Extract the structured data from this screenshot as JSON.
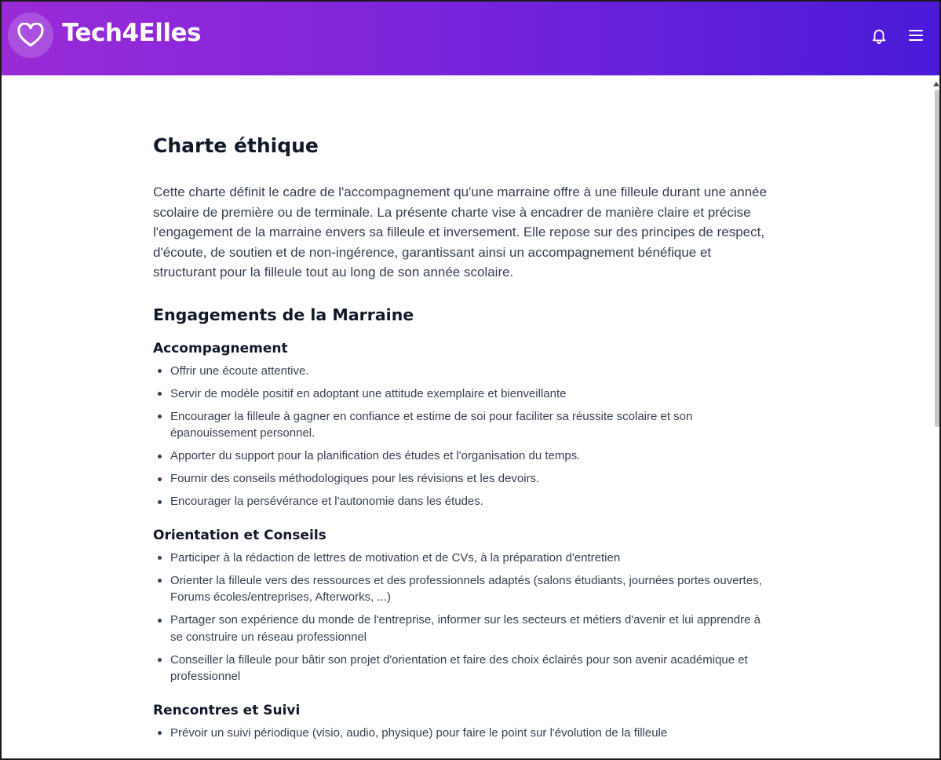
{
  "header": {
    "brand": "Tech4Elles",
    "logo_icon": "heart-icon",
    "notification_icon": "bell-icon",
    "menu_icon": "hamburger-menu-icon",
    "gradient_start": "#9a2bd6",
    "gradient_end": "#4a1ad8"
  },
  "page": {
    "title": "Charte éthique",
    "intro": "Cette charte définit le cadre de l'accompagnement qu'une marraine offre à une filleule durant une année scolaire de première ou de terminale. La présente charte vise à encadrer de manière claire et précise l'engagement de la marraine envers sa filleule et inversement. Elle repose sur des principes de respect, d'écoute, de soutien et de non-ingérence, garantissant ainsi un accompagnement bénéfique et structurant pour la filleule tout au long de son année scolaire.",
    "section_title": "Engagements de la Marraine",
    "subsections": [
      {
        "title": "Accompagnement",
        "items": [
          "Offrir une écoute attentive.",
          "Servir de modèle positif en adoptant une attitude exemplaire et bienveillante",
          "Encourager la filleule à gagner en confiance et estime de soi pour faciliter sa réussite scolaire et son épanouissement personnel.",
          "Apporter du support pour la planification des études et l'organisation du temps.",
          "Fournir des conseils méthodologiques pour les révisions et les devoirs.",
          "Encourager la persévérance et l'autonomie dans les études."
        ]
      },
      {
        "title": "Orientation et Conseils",
        "items": [
          "Participer à la rédaction de lettres de motivation et de CVs, à la préparation d'entretien",
          "Orienter la filleule vers des ressources et des professionnels adaptés (salons étudiants, journées portes ouvertes, Forums écoles/entreprises, Afterworks, ...)",
          "Partager son expérience du monde de l'entreprise, informer sur les secteurs et métiers d'avenir et lui apprendre à se construire un réseau professionnel",
          "Conseiller la filleule pour bâtir son projet d'orientation et faire des choix éclairés pour son avenir académique et professionnel"
        ]
      },
      {
        "title": "Rencontres et Suivi",
        "items": [
          "Prévoir un suivi périodique (visio, audio, physique) pour faire le point sur l'évolution de la filleule"
        ]
      }
    ]
  }
}
